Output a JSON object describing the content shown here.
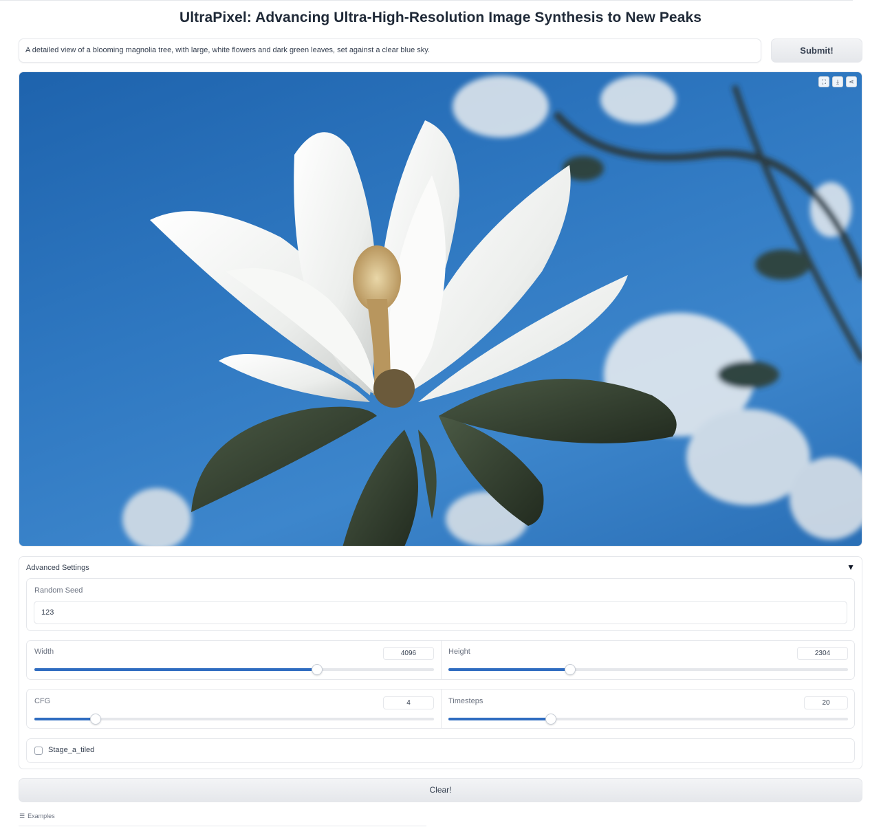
{
  "header": {
    "title": "UltraPixel: Advancing Ultra-High-Resolution Image Synthesis to New Peaks"
  },
  "prompt": {
    "value": "A detailed view of a blooming magnolia tree, with large, white flowers and dark green leaves, set against a clear blue sky."
  },
  "submit": {
    "label": "Submit!"
  },
  "output_image": {
    "subject": "white magnolia blossom with dark green leaves against blue sky",
    "tools": [
      {
        "name": "fullscreen-icon",
        "glyph": "⛶"
      },
      {
        "name": "download-icon",
        "glyph": "⤓"
      },
      {
        "name": "share-icon",
        "glyph": "⋖"
      }
    ],
    "colors": {
      "sky": "#2f78c1",
      "petal": "#f2f3f1",
      "leaf": "#2f3a2a"
    }
  },
  "advanced": {
    "title": "Advanced Settings",
    "caret": "▼",
    "seed": {
      "label": "Random Seed",
      "value": "123"
    },
    "width": {
      "label": "Width",
      "value": "4096",
      "fraction": 0.707
    },
    "height": {
      "label": "Height",
      "value": "2304",
      "fraction": 0.304
    },
    "cfg": {
      "label": "CFG",
      "value": "4",
      "fraction": 0.153
    },
    "timesteps": {
      "label": "Timesteps",
      "value": "20",
      "fraction": 0.257
    },
    "tiled": {
      "label": "Stage_a_tiled",
      "checked": false
    },
    "accent": "#2f6cc0"
  },
  "clear": {
    "label": "Clear!"
  },
  "examples": {
    "label": "Examples",
    "icon": "☰"
  }
}
